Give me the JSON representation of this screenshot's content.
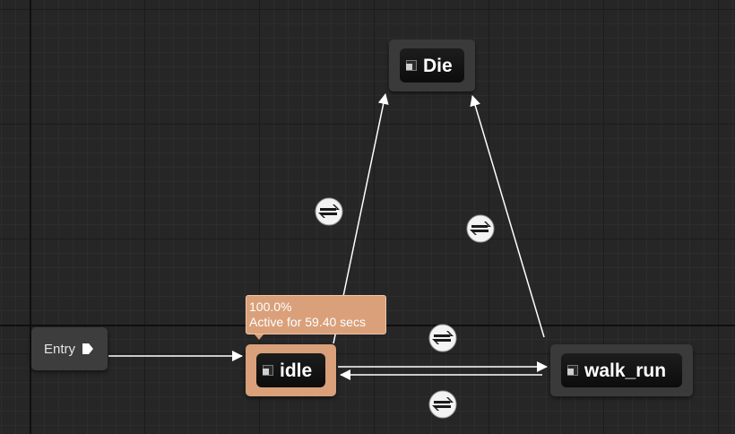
{
  "graph": {
    "entry": {
      "label": "Entry",
      "pin_icon": "entry-arrow-icon"
    },
    "states": {
      "idle": {
        "label": "idle",
        "active": true,
        "icon": "state-icon"
      },
      "walk_run": {
        "label": "walk_run",
        "active": false,
        "icon": "state-icon"
      },
      "die": {
        "label": "Die",
        "active": false,
        "icon": "state-icon"
      }
    },
    "active_tooltip": {
      "weight": "100.0%",
      "active_for": "Active for 59.40 secs"
    },
    "transitions": [
      {
        "from": "Entry",
        "to": "idle",
        "rule_icon": false
      },
      {
        "from": "idle",
        "to": "walk_run",
        "rule_icon": "transition-rule-icon"
      },
      {
        "from": "walk_run",
        "to": "idle",
        "rule_icon": "transition-rule-icon"
      },
      {
        "from": "idle",
        "to": "Die",
        "rule_icon": "transition-rule-icon"
      },
      {
        "from": "walk_run",
        "to": "Die",
        "rule_icon": "transition-rule-icon"
      }
    ]
  },
  "colors": {
    "canvas_background": "#262626",
    "node_background": "#3a3a3a",
    "active_state": "#d9a07a",
    "wire": "#ffffff"
  }
}
